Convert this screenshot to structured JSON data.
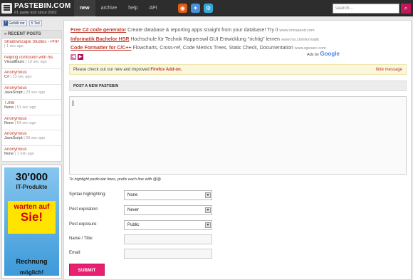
{
  "header": {
    "logo_text": "PASTEBIN.COM",
    "tagline": "#1 paste tool since 2002",
    "nav": [
      {
        "label": "new",
        "active": true
      },
      {
        "label": "archive",
        "active": false
      },
      {
        "label": "help",
        "active": false
      },
      {
        "label": "API",
        "active": false
      }
    ],
    "tool_icons": [
      {
        "name": "firefox-addon-icon",
        "color": "#e55b13"
      },
      {
        "name": "chrome-extension-icon",
        "color": "#4a8fd8"
      },
      {
        "name": "mobile-app-icon",
        "color": "#35a7d8"
      }
    ],
    "search_placeholder": "search..."
  },
  "sidebar": {
    "like_label": "Gefällt mir",
    "like_count": "5 Tsd",
    "recent_title": "» RECENT POSTS",
    "recent": [
      {
        "title": "Shadowscape Studios - PHP",
        "lang": "",
        "time": "1 sec ago"
      },
      {
        "title": "helping confusion with his",
        "lang": "VisualBasic",
        "time": "10 sec ago"
      },
      {
        "title": "Anonymous",
        "lang": "C#",
        "time": "13 sec ago"
      },
      {
        "title": "Anonymous",
        "lang": "JavaScript",
        "time": "23 sec ago"
      },
      {
        "title": "TJN8",
        "lang": "None",
        "time": "51 sec ago"
      },
      {
        "title": "Anonymous",
        "lang": "None",
        "time": "54 sec ago"
      },
      {
        "title": "Anonymous",
        "lang": "JavaScript",
        "time": "59 sec ago"
      },
      {
        "title": "Anonymous",
        "lang": "None",
        "time": "1 min ago"
      }
    ],
    "ad": {
      "big": "30'000",
      "sub": "IT-Produkte",
      "band_line1": "warten auf",
      "band_line2": "Sie!",
      "line3": "Rechnung",
      "line4": "möglich!"
    }
  },
  "ads": [
    {
      "link": "Free C# code generator",
      "text": "Create database & reporting apps straight from your database! Try it",
      "url": "www.ironspeed.com"
    },
    {
      "link": "Informatik Bachelor HSR",
      "text": "Hochschule für Technik Rapperswil GUI Entwicklung \"richtig\" lernen",
      "url": "www.hsr.ch/informatik"
    },
    {
      "link": "Code Formatter for C/C++",
      "text": "Flowcharts, Cross-ref, Code Metrics Trees, Static Check, Documentation",
      "url": "www.sgvsarc.com"
    }
  ],
  "ads_by": "Ads by",
  "ads_brand": "Google",
  "notice": {
    "text": "Please check out our new and improved",
    "link": "Firefox Add-on.",
    "hide": "hide message"
  },
  "section_title": "POST A NEW PASTEBIN",
  "hint": "To highlight particular lines, prefix each line with @@",
  "form": {
    "syntax_label": "Syntax highlighting:",
    "syntax_value": "None",
    "expiration_label": "Post expiration:",
    "expiration_value": "Never",
    "exposure_label": "Post exposure:",
    "exposure_value": "Public",
    "name_label": "Name / Title:",
    "email_label": "Email:",
    "submit_label": "SUBMIT"
  }
}
